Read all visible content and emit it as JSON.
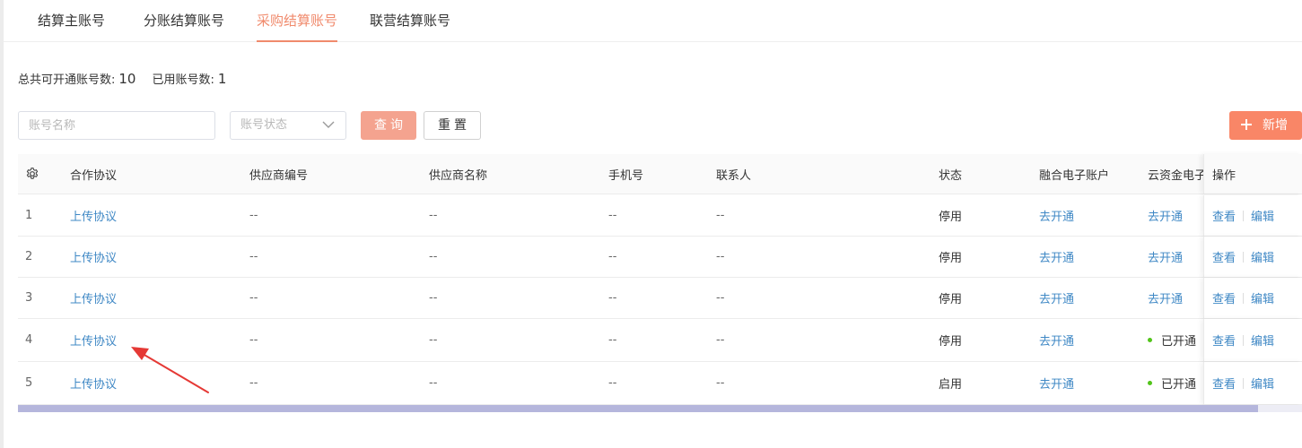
{
  "tabs": [
    {
      "label": "结算主账号",
      "active": false
    },
    {
      "label": "分账结算账号",
      "active": false
    },
    {
      "label": "采购结算账号",
      "active": true
    },
    {
      "label": "联营结算账号",
      "active": false
    }
  ],
  "summary": {
    "total_label": "总共可开通账号数:",
    "total_value": "10",
    "used_label": "已用账号数:",
    "used_value": "1"
  },
  "filters": {
    "account_name_placeholder": "账号名称",
    "status_placeholder": "账号状态",
    "query_label": "查询",
    "reset_label": "重置",
    "add_label": "新增"
  },
  "table": {
    "columns": [
      "合作协议",
      "供应商编号",
      "供应商名称",
      "手机号",
      "联系人",
      "状态",
      "融合电子账户",
      "云资金电子",
      "操作"
    ],
    "rows": [
      {
        "index": "1",
        "agreement": "上传协议",
        "supplier_no": "--",
        "supplier_name": "--",
        "phone": "--",
        "contact": "--",
        "status": "停用",
        "fusion_account": "去开通",
        "cloud_account": "去开通",
        "cloud_opened": false,
        "view": "查看",
        "edit": "编辑"
      },
      {
        "index": "2",
        "agreement": "上传协议",
        "supplier_no": "--",
        "supplier_name": "--",
        "phone": "--",
        "contact": "--",
        "status": "停用",
        "fusion_account": "去开通",
        "cloud_account": "去开通",
        "cloud_opened": false,
        "view": "查看",
        "edit": "编辑"
      },
      {
        "index": "3",
        "agreement": "上传协议",
        "supplier_no": "--",
        "supplier_name": "--",
        "phone": "--",
        "contact": "--",
        "status": "停用",
        "fusion_account": "去开通",
        "cloud_account": "去开通",
        "cloud_opened": false,
        "view": "查看",
        "edit": "编辑"
      },
      {
        "index": "4",
        "agreement": "上传协议",
        "supplier_no": "--",
        "supplier_name": "--",
        "phone": "--",
        "contact": "--",
        "status": "停用",
        "fusion_account": "去开通",
        "cloud_account": "已开通",
        "cloud_opened": true,
        "view": "查看",
        "edit": "编辑"
      },
      {
        "index": "5",
        "agreement": "上传协议",
        "supplier_no": "--",
        "supplier_name": "--",
        "phone": "--",
        "contact": "--",
        "status": "启用",
        "fusion_account": "去开通",
        "cloud_account": "已开通",
        "cloud_opened": true,
        "view": "查看",
        "edit": "编辑"
      }
    ]
  },
  "colors": {
    "accent": "#f08a6c",
    "link": "#3f88c5",
    "status_dot": "#52c41a",
    "annotation_arrow": "#e53935"
  }
}
